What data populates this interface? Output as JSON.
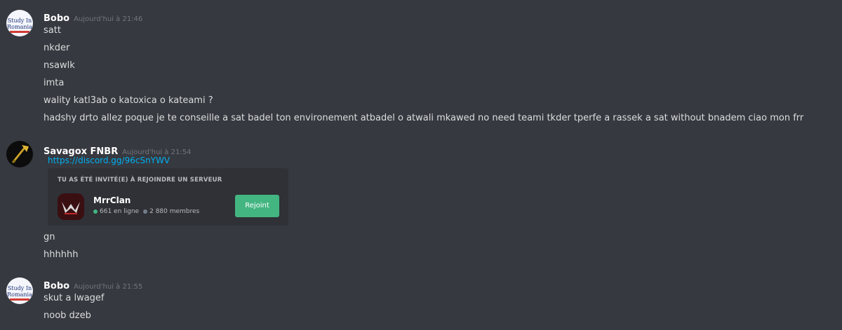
{
  "messages": [
    {
      "username": "Bobo",
      "timestamp": "Aujourd'hui à 21:46",
      "avatar_text": [
        "Study In",
        "Romania"
      ],
      "lines": [
        "satt",
        "nkder",
        "nsawlk",
        "imta",
        "wality katl3ab o katoxica o kateami ?",
        "hadshy drto allez poque je te conseille a sat badel ton environement atbadel o atwali mkawed no need teami tkder tperfe a rassek a sat without bnadem ciao mon frr"
      ]
    },
    {
      "username": "Savagox FNBR",
      "timestamp": "Aujourd'hui à 21:54",
      "link": "https://discord.gg/96cSnYWV",
      "invite": {
        "title": "TU AS ÉTÉ INVITÉ(E) À REJOINDRE UN SERVEUR",
        "server_name": "MrrClan",
        "online": "661 en ligne",
        "members": "2 880 membres",
        "join_label": "Rejoint",
        "join_color": "#43b581"
      },
      "lines": [
        "gn",
        "hhhhhh"
      ]
    },
    {
      "username": "Bobo",
      "timestamp": "Aujourd'hui à 21:55",
      "avatar_text": [
        "Study In",
        "Romania"
      ],
      "lines": [
        "skut a lwagef",
        "noob dzeb"
      ]
    }
  ],
  "colors": {
    "background": "#36393f",
    "link": "#00b0f4",
    "embed_bg": "#2f3136",
    "online": "#43b581"
  }
}
